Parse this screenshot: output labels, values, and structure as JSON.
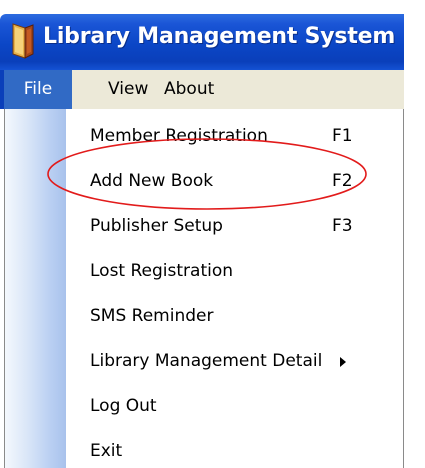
{
  "window": {
    "title": "Library Management System",
    "icon": "book-icon"
  },
  "menubar": {
    "items": [
      {
        "label": "File",
        "active": true
      },
      {
        "label": "View",
        "active": false
      },
      {
        "label": "About",
        "active": false
      }
    ]
  },
  "file_menu": {
    "items": [
      {
        "label": "Member Registration",
        "shortcut": "F1"
      },
      {
        "label": "Add New Book",
        "shortcut": "F2",
        "highlighted_by_annotation": true
      },
      {
        "label": "Publisher Setup",
        "shortcut": "F3"
      },
      {
        "label": "Lost Registration",
        "shortcut": ""
      },
      {
        "label": "SMS Reminder",
        "shortcut": ""
      },
      {
        "label": "Library Management Detail",
        "shortcut": "",
        "has_submenu": true
      },
      {
        "label": "Log Out",
        "shortcut": ""
      },
      {
        "label": "Exit",
        "shortcut": ""
      }
    ]
  },
  "colors": {
    "titlebar": "#0a46c6",
    "menu_active": "#316ac5",
    "annotation": "#e21b1b",
    "menubar_bg": "#ece9d8"
  }
}
